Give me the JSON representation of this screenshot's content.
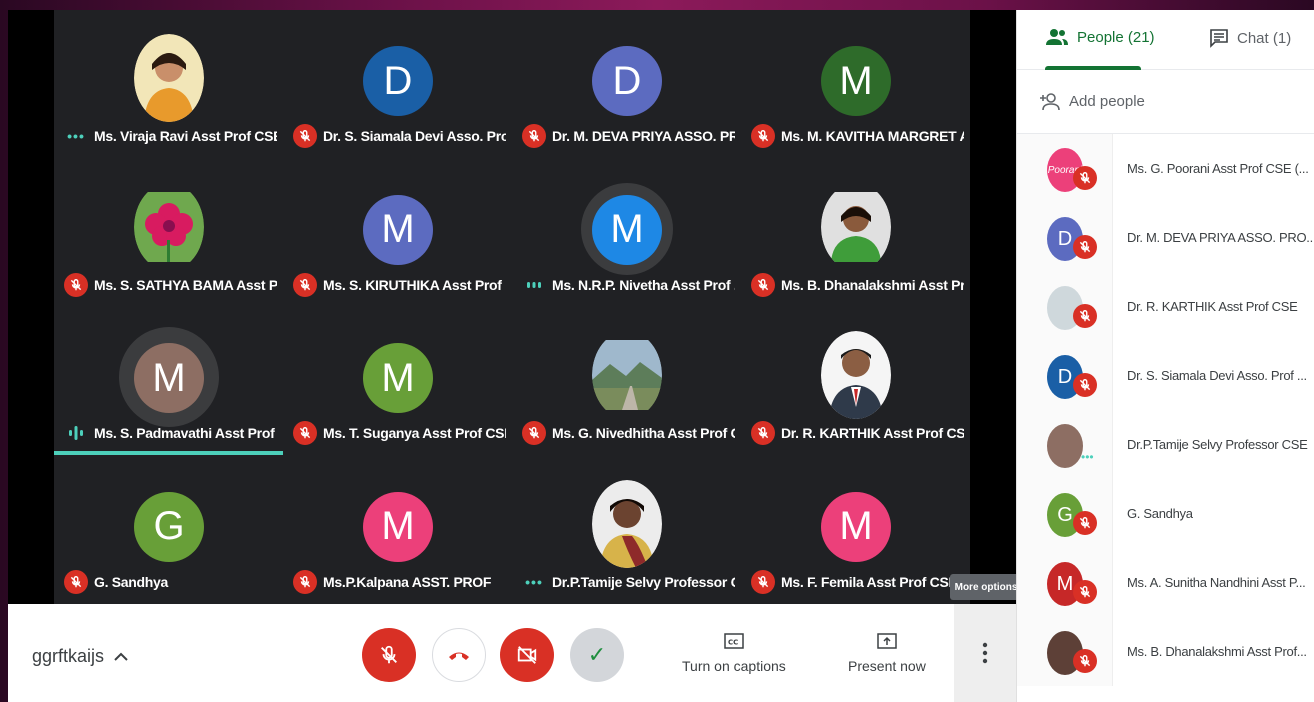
{
  "colors": {
    "teal": "#4dd0bb",
    "mic_red": "#d93025",
    "green": "#137333"
  },
  "tiles": [
    {
      "name": "Ms. Viraja Ravi Asst Prof CSE",
      "initial": "",
      "color": "",
      "photo": "person-yellow",
      "status": "dots"
    },
    {
      "name": "Dr. S. Siamala Devi Asso. Prof...",
      "initial": "D",
      "color": "#1a5fa6",
      "status": "mic-off"
    },
    {
      "name": "Dr. M. DEVA PRIYA ASSO. PR...",
      "initial": "D",
      "color": "#5c6bc0",
      "status": "mic-off"
    },
    {
      "name": "Ms. M. KAVITHA MARGRET A...",
      "initial": "M",
      "color": "#2e6b2a",
      "status": "mic-off"
    },
    {
      "name": "Ms. S. SATHYA BAMA Asst Pr...",
      "initial": "",
      "color": "",
      "photo": "flower",
      "status": "mic-off"
    },
    {
      "name": "Ms. S. KIRUTHIKA Asst Prof ...",
      "initial": "M",
      "color": "#5c6bc0",
      "status": "mic-off"
    },
    {
      "name": "Ms. N.R.P. Nivetha Asst Prof ...",
      "initial": "M",
      "color": "#1e88e5",
      "status": "speaking"
    },
    {
      "name": "Ms. B. Dhanalakshmi Asst Pr...",
      "initial": "",
      "color": "",
      "photo": "person-green",
      "status": "mic-off"
    },
    {
      "name": "Ms. S. Padmavathi Asst Prof ...",
      "initial": "M",
      "color": "#8d6e63",
      "status": "speaking-active"
    },
    {
      "name": "Ms. T. Suganya Asst Prof CSE",
      "initial": "M",
      "color": "#689f38",
      "status": "mic-off"
    },
    {
      "name": "Ms. G. Nivedhitha Asst Prof C...",
      "initial": "",
      "color": "",
      "photo": "landscape",
      "status": "mic-off"
    },
    {
      "name": "Dr. R. KARTHIK Asst Prof CSE",
      "initial": "",
      "color": "",
      "photo": "person-suit",
      "status": "mic-off"
    },
    {
      "name": "G. Sandhya",
      "initial": "G",
      "color": "#689f38",
      "status": "mic-off"
    },
    {
      "name": "Ms.P.Kalpana ASST. PROF",
      "initial": "M",
      "color": "#ec407a",
      "status": "mic-off"
    },
    {
      "name": "Dr.P.Tamije Selvy Professor C...",
      "initial": "",
      "color": "",
      "photo": "person-saree",
      "status": "dots"
    },
    {
      "name": "Ms. F. Femila Asst Prof CSE",
      "initial": "M",
      "color": "#ec407a",
      "status": "mic-off"
    }
  ],
  "bottom": {
    "meeting_code": "ggrftkaijs",
    "captions_label": "Turn on captions",
    "present_label": "Present now",
    "tooltip": "More options"
  },
  "panel": {
    "people_tab": "People (21)",
    "chat_tab": "Chat (1)",
    "add_people": "Add people",
    "people": [
      {
        "name": "Ms. G. Poorani Asst Prof CSE (...",
        "initial": "Poorani",
        "color": "#ec407a",
        "status": "mic-off"
      },
      {
        "name": "Dr. M. DEVA PRIYA ASSO. PRO...",
        "initial": "D",
        "color": "#5c6bc0",
        "status": "mic-off"
      },
      {
        "name": "Dr. R. KARTHIK Asst Prof CSE",
        "initial": "",
        "color": "#cfd8dc",
        "status": "mic-off"
      },
      {
        "name": "Dr. S. Siamala Devi Asso. Prof ...",
        "initial": "D",
        "color": "#1a5fa6",
        "status": "mic-off"
      },
      {
        "name": "Dr.P.Tamije Selvy Professor CSE",
        "initial": "",
        "color": "#8d6e63",
        "status": "dots"
      },
      {
        "name": "G. Sandhya",
        "initial": "G",
        "color": "#689f38",
        "status": "mic-off"
      },
      {
        "name": "Ms. A. Sunitha Nandhini Asst P...",
        "initial": "M",
        "color": "#c62828",
        "status": "mic-off"
      },
      {
        "name": "Ms. B. Dhanalakshmi Asst Prof...",
        "initial": "",
        "color": "#5d4037",
        "status": "mic-off"
      }
    ]
  }
}
